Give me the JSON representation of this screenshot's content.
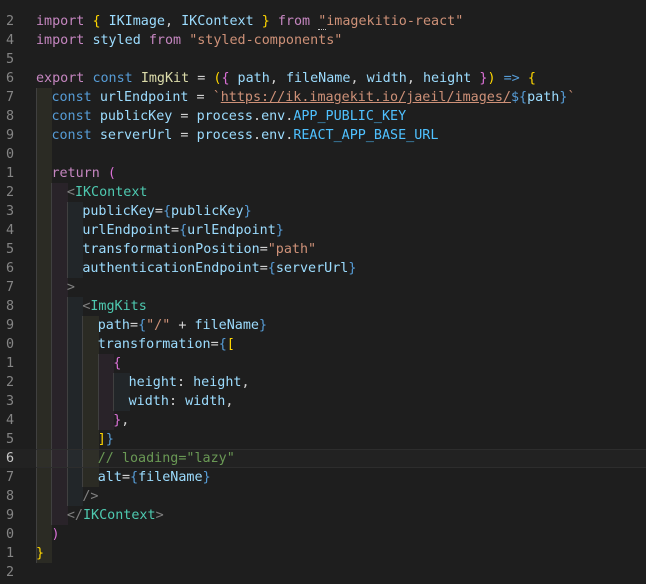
{
  "editor": {
    "active_line": 16,
    "lines": [
      {
        "num": "2",
        "segments": [
          [
            "import ",
            "kw-p"
          ],
          [
            "{ ",
            "br1"
          ],
          [
            "IKImage",
            "var"
          ],
          [
            ", ",
            ""
          ],
          [
            "IKContext",
            "var"
          ],
          [
            " }",
            "br1"
          ],
          [
            " from ",
            "kw-p"
          ],
          [
            "\"",
            "str squig"
          ],
          [
            "imagekitio-react\"",
            "str"
          ]
        ]
      },
      {
        "num": "4",
        "segments": [
          [
            "import ",
            "kw-p"
          ],
          [
            "styled",
            "var"
          ],
          [
            " from ",
            "kw-p"
          ],
          [
            "\"styled-components\"",
            "str"
          ]
        ]
      },
      {
        "num": "5",
        "segments": []
      },
      {
        "num": "6",
        "segments": [
          [
            "export ",
            "kw-p"
          ],
          [
            "const ",
            "kw-b"
          ],
          [
            "ImgKit",
            "fn"
          ],
          [
            " = ",
            ""
          ],
          [
            "(",
            "br1"
          ],
          [
            "{",
            "br2"
          ],
          [
            " path",
            "var"
          ],
          [
            ", ",
            ""
          ],
          [
            "fileName",
            "var"
          ],
          [
            ", ",
            ""
          ],
          [
            "width",
            "var"
          ],
          [
            ", ",
            ""
          ],
          [
            "height",
            "var"
          ],
          [
            " }",
            "br2"
          ],
          [
            ")",
            "br1"
          ],
          [
            " ",
            ""
          ],
          [
            "=>",
            "kw-b"
          ],
          [
            " ",
            ""
          ],
          [
            "{",
            "br1"
          ]
        ]
      },
      {
        "num": "7",
        "segments": [
          [
            "const ",
            "kw-b"
          ],
          [
            "urlEndpoint",
            "var"
          ],
          [
            " = ",
            ""
          ],
          [
            "`",
            "str"
          ],
          [
            "https://ik.imagekit.io/jaeil/images/",
            "url"
          ],
          [
            "${",
            "kw-b"
          ],
          [
            "path",
            "var"
          ],
          [
            "}",
            "kw-b"
          ],
          [
            "`",
            "str"
          ]
        ]
      },
      {
        "num": "8",
        "segments": [
          [
            "const ",
            "kw-b"
          ],
          [
            "publicKey",
            "var"
          ],
          [
            " = ",
            ""
          ],
          [
            "process",
            "var"
          ],
          [
            ".",
            ""
          ],
          [
            "env",
            "var"
          ],
          [
            ".",
            ""
          ],
          [
            "APP_PUBLIC_KEY",
            "con"
          ]
        ]
      },
      {
        "num": "9",
        "segments": [
          [
            "const ",
            "kw-b"
          ],
          [
            "serverUrl",
            "var"
          ],
          [
            " = ",
            ""
          ],
          [
            "process",
            "var"
          ],
          [
            ".",
            ""
          ],
          [
            "env",
            "var"
          ],
          [
            ".",
            ""
          ],
          [
            "REACT_APP_BASE_URL",
            "con"
          ]
        ]
      },
      {
        "num": "0",
        "segments": []
      },
      {
        "num": "1",
        "segments": [
          [
            "return ",
            "kw-p"
          ],
          [
            "(",
            "br2"
          ]
        ]
      },
      {
        "num": "2",
        "segments": [
          [
            "<",
            "pun"
          ],
          [
            "IKContext",
            "tag"
          ]
        ]
      },
      {
        "num": "3",
        "segments": [
          [
            "publicKey",
            "var"
          ],
          [
            "=",
            ""
          ],
          [
            "{",
            "kw-b"
          ],
          [
            "publicKey",
            "var"
          ],
          [
            "}",
            "kw-b"
          ]
        ]
      },
      {
        "num": "4",
        "segments": [
          [
            "urlEndpoint",
            "var"
          ],
          [
            "=",
            ""
          ],
          [
            "{",
            "kw-b"
          ],
          [
            "urlEndpoint",
            "var"
          ],
          [
            "}",
            "kw-b"
          ]
        ]
      },
      {
        "num": "5",
        "segments": [
          [
            "transformationPosition",
            "var"
          ],
          [
            "=",
            ""
          ],
          [
            "\"path\"",
            "str"
          ]
        ]
      },
      {
        "num": "6",
        "segments": [
          [
            "authenticationEndpoint",
            "var"
          ],
          [
            "=",
            ""
          ],
          [
            "{",
            "kw-b"
          ],
          [
            "serverUrl",
            "var"
          ],
          [
            "}",
            "kw-b"
          ]
        ]
      },
      {
        "num": "7",
        "segments": [
          [
            ">",
            "pun"
          ]
        ]
      },
      {
        "num": "8",
        "segments": [
          [
            "<",
            "pun"
          ],
          [
            "ImgKits",
            "tag"
          ]
        ]
      },
      {
        "num": "9",
        "segments": [
          [
            "path",
            "var"
          ],
          [
            "=",
            ""
          ],
          [
            "{",
            "kw-b"
          ],
          [
            "\"/\"",
            "str"
          ],
          [
            " + ",
            ""
          ],
          [
            "fileName",
            "var"
          ],
          [
            "}",
            "kw-b"
          ]
        ]
      },
      {
        "num": "0",
        "segments": [
          [
            "transformation",
            "var"
          ],
          [
            "=",
            ""
          ],
          [
            "{",
            "kw-b"
          ],
          [
            "[",
            "br1"
          ]
        ]
      },
      {
        "num": "1",
        "segments": [
          [
            "{",
            "br2"
          ]
        ]
      },
      {
        "num": "2",
        "segments": [
          [
            "height",
            "var"
          ],
          [
            ": ",
            ""
          ],
          [
            "height",
            "var"
          ],
          [
            ",",
            ""
          ]
        ]
      },
      {
        "num": "3",
        "segments": [
          [
            "width",
            "var"
          ],
          [
            ": ",
            ""
          ],
          [
            "width",
            "var"
          ],
          [
            ",",
            ""
          ]
        ]
      },
      {
        "num": "4",
        "segments": [
          [
            "}",
            "br2"
          ],
          [
            ",",
            ""
          ]
        ]
      },
      {
        "num": "5",
        "segments": [
          [
            "]",
            "br1"
          ],
          [
            "}",
            "kw-b"
          ]
        ]
      },
      {
        "num": "6",
        "segments": [
          [
            "// loading=\"lazy\"",
            "cmt"
          ]
        ]
      },
      {
        "num": "7",
        "segments": [
          [
            "alt",
            "var"
          ],
          [
            "=",
            ""
          ],
          [
            "{",
            "kw-b"
          ],
          [
            "fileName",
            "var"
          ],
          [
            "}",
            "kw-b"
          ]
        ]
      },
      {
        "num": "8",
        "segments": [
          [
            "/>",
            "pun"
          ]
        ]
      },
      {
        "num": "9",
        "segments": [
          [
            "</",
            "pun"
          ],
          [
            "IKContext",
            "tag"
          ],
          [
            ">",
            "pun"
          ]
        ]
      },
      {
        "num": "0",
        "segments": [
          [
            ")",
            "br2"
          ]
        ]
      },
      {
        "num": "1",
        "segments": [
          [
            "}",
            "br1"
          ]
        ]
      },
      {
        "num": "2",
        "segments": []
      }
    ]
  }
}
